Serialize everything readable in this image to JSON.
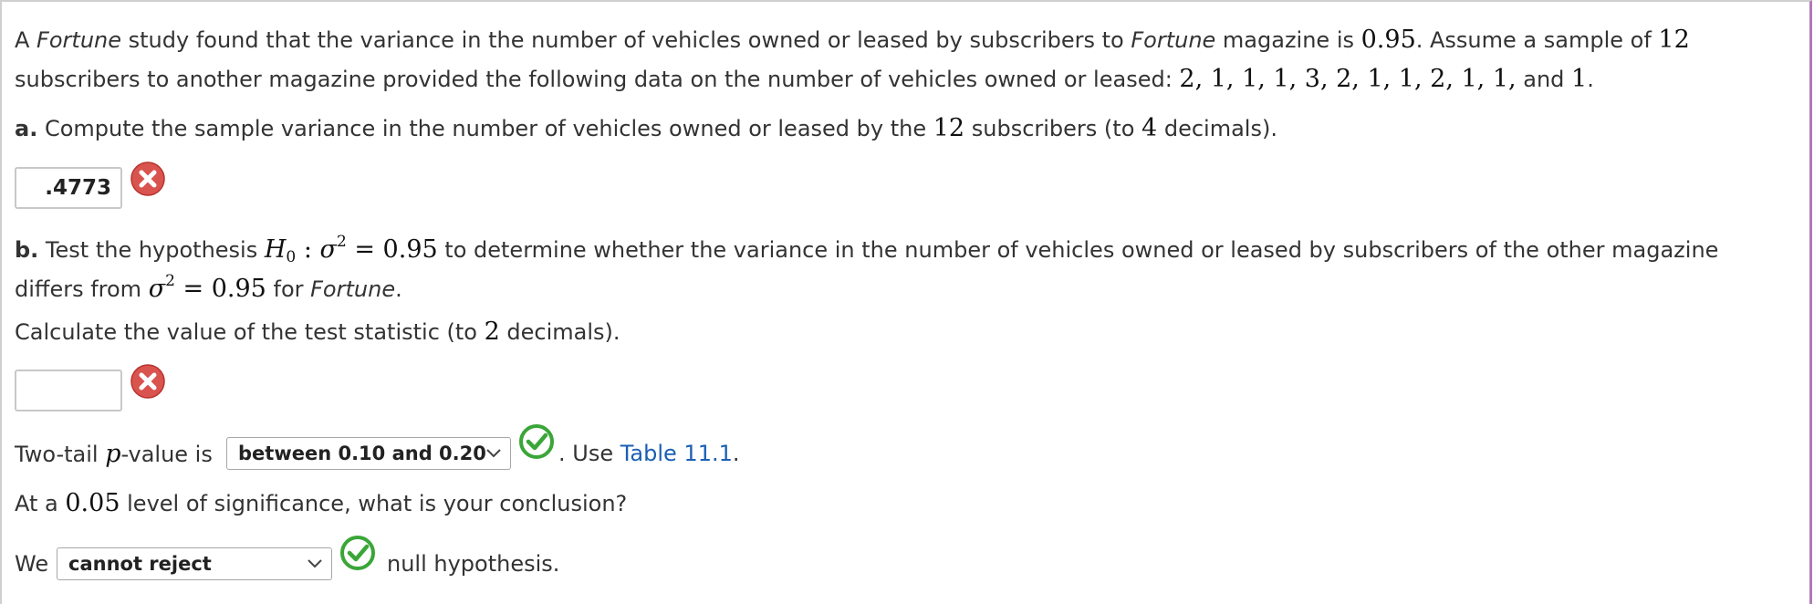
{
  "problem": {
    "intro_l1_a": "A ",
    "intro_fortune_1": "Fortune",
    "intro_l1_b": " study found that the variance in the number of vehicles owned or leased by subscribers to ",
    "intro_fortune_2": "Fortune",
    "intro_l1_c": " magazine is ",
    "intro_variance": "0.95",
    "intro_l1_d": ". Assume a sample of ",
    "intro_n": "12",
    "intro_l2_a": "subscribers to another magazine provided the following data on the number of vehicles owned or leased: ",
    "data_values": "2, 1, 1, 1, 3, 2, 1, 1, 2, 1, 1,",
    "intro_l2_and": " and ",
    "data_last": "1",
    "intro_l2_end": "."
  },
  "part_a": {
    "label": "a.",
    "q_a": " Compute the sample variance in the number of vehicles owned or leased by the ",
    "q_n": "12",
    "q_b": " subscribers (to ",
    "q_dec": "4",
    "q_c": " decimals).",
    "answer": ".4773",
    "status_icon": "incorrect-x-icon"
  },
  "part_b": {
    "label": "b.",
    "q_a": " Test the hypothesis ",
    "h0_H": "H",
    "h0_sub": "0",
    "h0_colon": " : ",
    "sigma": "σ",
    "sq": "2",
    "eq_val": " = 0.95",
    "q_b": " to determine whether the variance in the number of vehicles owned or leased by subscribers of the other magazine",
    "q_l2_a": "differs from ",
    "q_l2_val": " = 0.95",
    "q_l2_b": " for ",
    "q_l2_fortune": "Fortune",
    "q_l2_end": ".",
    "calc_a": "Calculate the value of the test statistic (to ",
    "calc_dec": "2",
    "calc_b": " decimals).",
    "test_stat_answer": "",
    "test_stat_status_icon": "incorrect-x-icon",
    "pvalue_a": "Two-tail ",
    "pvalue_p": "p",
    "pvalue_b": "-value is",
    "pvalue_selected": "between 0.10 and 0.20",
    "pvalue_status_icon": "correct-check-icon",
    "use_a": ". Use ",
    "table_link": "Table 11.1",
    "use_end": ".",
    "sig_a": "At a ",
    "sig_val": "0.05",
    "sig_b": " level of significance, what is your conclusion?",
    "we": "We",
    "conclusion_selected": "cannot reject",
    "conclusion_status_icon": "correct-check-icon",
    "null_hyp": "null hypothesis."
  },
  "colors": {
    "incorrect": "#d9534f",
    "correct": "#3aa638",
    "link": "#1a5fb4",
    "frame_right": "#b07ab8"
  }
}
